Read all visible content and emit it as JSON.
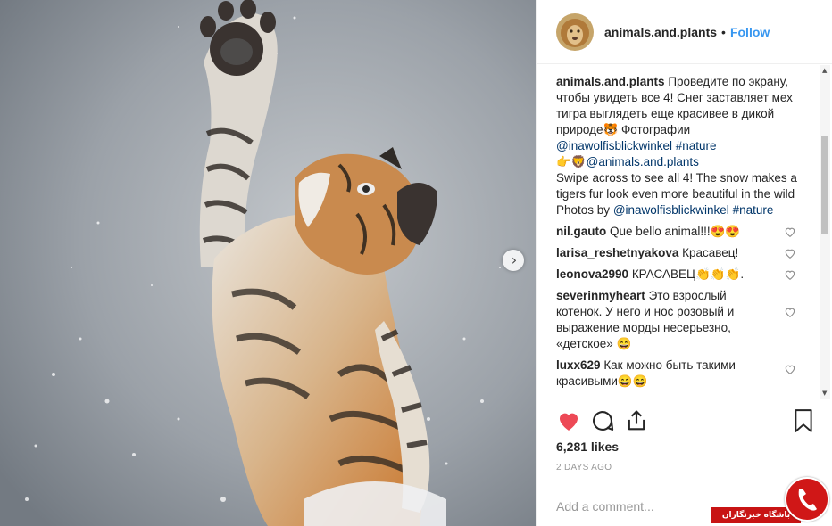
{
  "post": {
    "username": "animals.and.plants",
    "separator": "•",
    "follow_label": "Follow"
  },
  "caption": {
    "username": "animals.and.plants",
    "text_ru": "Проведите по экрану, чтобы увидеть все 4! Снег заставляет мех тигра выглядеть еще красивее в дикой природе🐯 Фотографии",
    "mention1": "@inawolfisblickwinkel",
    "hashtag1": "#nature",
    "emoji_line_prefix": "👉🦁",
    "mention2": "@animals.and.plants",
    "text_en": "Swipe across to see all 4! The snow makes a tigers fur look even more beautiful in the wild",
    "photos_by": "Photos by",
    "mention3": "@inawolfisblickwinkel",
    "hashtag2": "#nature"
  },
  "comments": [
    {
      "username": "nil.gauto",
      "text": "Que bello animal!!!😍😍"
    },
    {
      "username": "larisa_reshetnyakova",
      "text": "Красавец!"
    },
    {
      "username": "leonova2990",
      "text": "КРАСАВЕЦ👏👏👏."
    },
    {
      "username": "severinmyheart",
      "text": "Это взрослый котенок. У него и нос розовый и выражение морды несерьезно, «детское» 😄"
    },
    {
      "username": "luxx629",
      "text": "Как можно быть такими красивыми😄😄"
    }
  ],
  "likes_text": "6,281 likes",
  "date_text": "2 DAYS AGO",
  "add_comment_placeholder": "Add a comment...",
  "watermark_text": "باشگاه خبرنگاران",
  "icons": {
    "like": "heart-filled-icon",
    "comment": "speech-bubble-icon",
    "share": "share-icon",
    "save": "bookmark-icon",
    "carousel_next": "chevron-right-icon"
  },
  "colors": {
    "like_red": "#ed4956",
    "link_blue": "#003569",
    "follow_blue": "#3897f0"
  }
}
